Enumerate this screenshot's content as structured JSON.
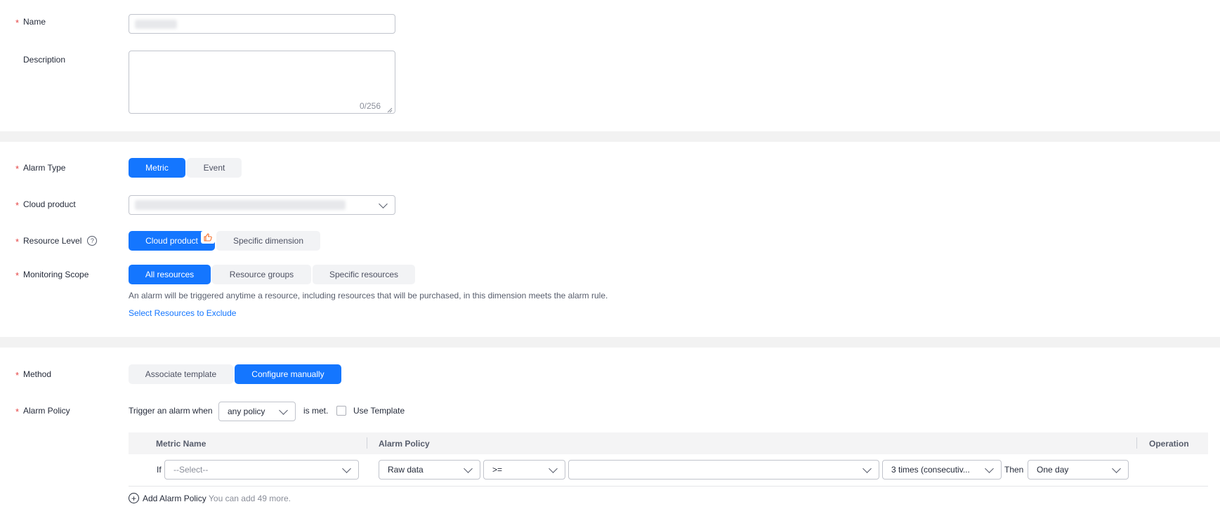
{
  "form": {
    "name_label": "Name",
    "description_label": "Description",
    "description_counter": "0/256",
    "alarm_type_label": "Alarm Type",
    "alarm_type_options": [
      "Metric",
      "Event"
    ],
    "cloud_product_label": "Cloud product",
    "resource_level_label": "Resource Level",
    "resource_level_options": [
      "Cloud product",
      "Specific dimension"
    ],
    "monitoring_scope_label": "Monitoring Scope",
    "monitoring_scope_options": [
      "All resources",
      "Resource groups",
      "Specific resources"
    ],
    "monitoring_scope_hint": "An alarm will be triggered anytime a resource, including resources that will be purchased, in this dimension meets the alarm rule.",
    "exclude_link": "Select Resources to Exclude",
    "method_label": "Method",
    "method_options": [
      "Associate template",
      "Configure manually"
    ],
    "alarm_policy_label": "Alarm Policy",
    "trigger_prefix": "Trigger an alarm when",
    "trigger_value": "any policy",
    "trigger_suffix": "is met.",
    "use_template_label": "Use Template"
  },
  "table": {
    "headers": {
      "metric_name": "Metric Name",
      "alarm_policy": "Alarm Policy",
      "operation": "Operation"
    },
    "row": {
      "if_label": "If",
      "metric_placeholder": "--Select--",
      "data_type": "Raw data",
      "operator": ">=",
      "threshold": "",
      "times": "3 times (consecutiv...",
      "then_label": "Then",
      "period": "One day"
    }
  },
  "add_policy": {
    "label": "Add Alarm Policy",
    "hint": "You can add 49 more."
  },
  "colors": {
    "primary": "#1476ff",
    "required": "#e54545",
    "section_band": "#f2f2f2"
  }
}
